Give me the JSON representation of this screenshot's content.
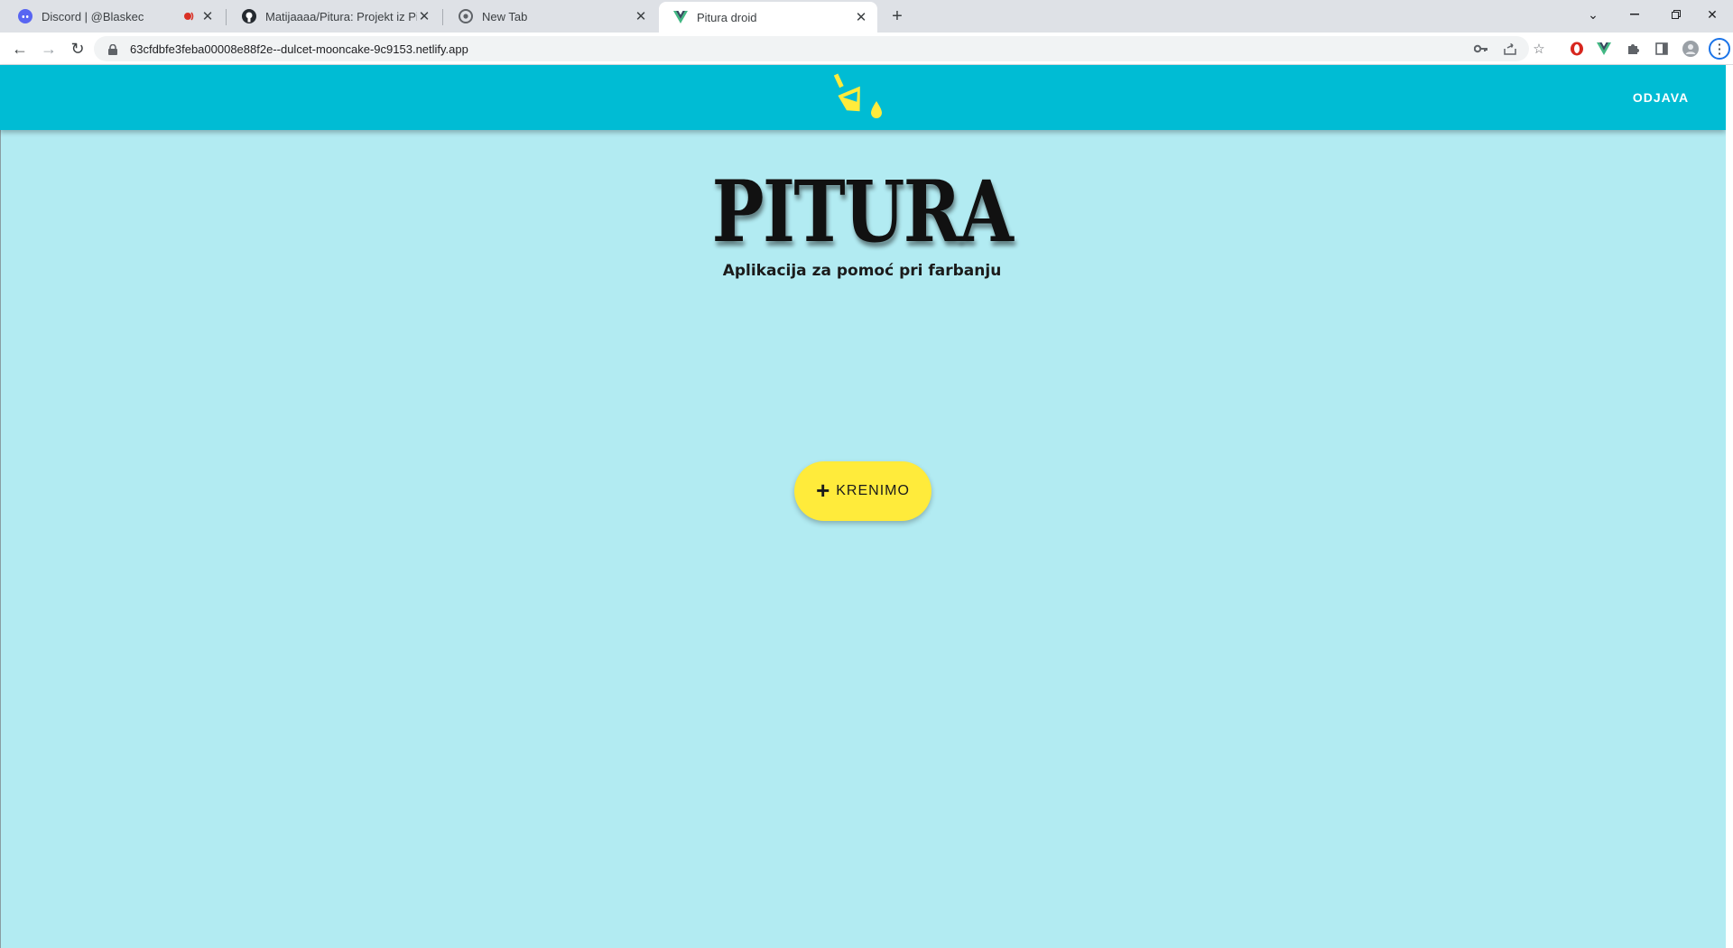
{
  "browser": {
    "tabs": [
      {
        "title": "Discord | @Blaskec",
        "icon": "discord-icon",
        "audio": true
      },
      {
        "title": "Matijaaaa/Pitura: Projekt iz Pi",
        "icon": "github-icon",
        "audio": false
      },
      {
        "title": "New Tab",
        "icon": "chrome-icon",
        "audio": false
      },
      {
        "title": "Pitura droid",
        "icon": "vue-icon",
        "audio": false
      }
    ],
    "url": "63cfdbfe3feba00008e88f2e--dulcet-mooncake-9c9153.netlify.app"
  },
  "app": {
    "logo": "paint-bucket-icon",
    "logout_label": "ODJAVA",
    "title": "PITURA",
    "subtitle": "Aplikacija za pomoć pri farbanju",
    "cta_label": "KRENIMO",
    "cta_icon": "plus-icon"
  },
  "colors": {
    "appbar": "#00bcd4",
    "background": "#b2ebf2",
    "accent": "#ffeb3b"
  }
}
